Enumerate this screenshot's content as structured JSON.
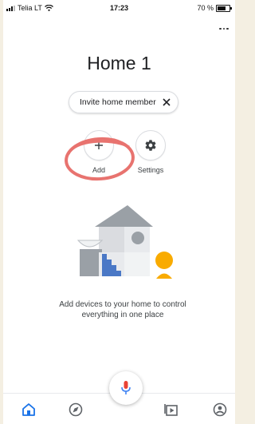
{
  "status_bar": {
    "carrier": "Telia LT",
    "time": "17:23",
    "battery": "70 %",
    "battery_level": 0.7
  },
  "header": {
    "title": "Home 1",
    "more_icon": "more-vert-icon"
  },
  "invite_chip": {
    "label": "Invite home member",
    "close_icon": "close-icon"
  },
  "actions": {
    "add_label": "Add",
    "add_icon": "plus-icon",
    "settings_label": "Settings",
    "settings_icon": "gear-icon"
  },
  "empty_state": {
    "message": "Add devices to your home to control everything in one place"
  },
  "bottom_nav": {
    "items": [
      "home-icon",
      "compass-icon",
      "media-icon",
      "account-icon"
    ],
    "fab_icon": "mic-icon"
  },
  "colors": {
    "annotation_circle": "#e8736f",
    "nav_active": "#1a73e8",
    "mic_red": "#ea4335",
    "mic_blue": "#4285f4",
    "stairs_blue": "#4a78c6",
    "person_yellow": "#f9ab00"
  }
}
